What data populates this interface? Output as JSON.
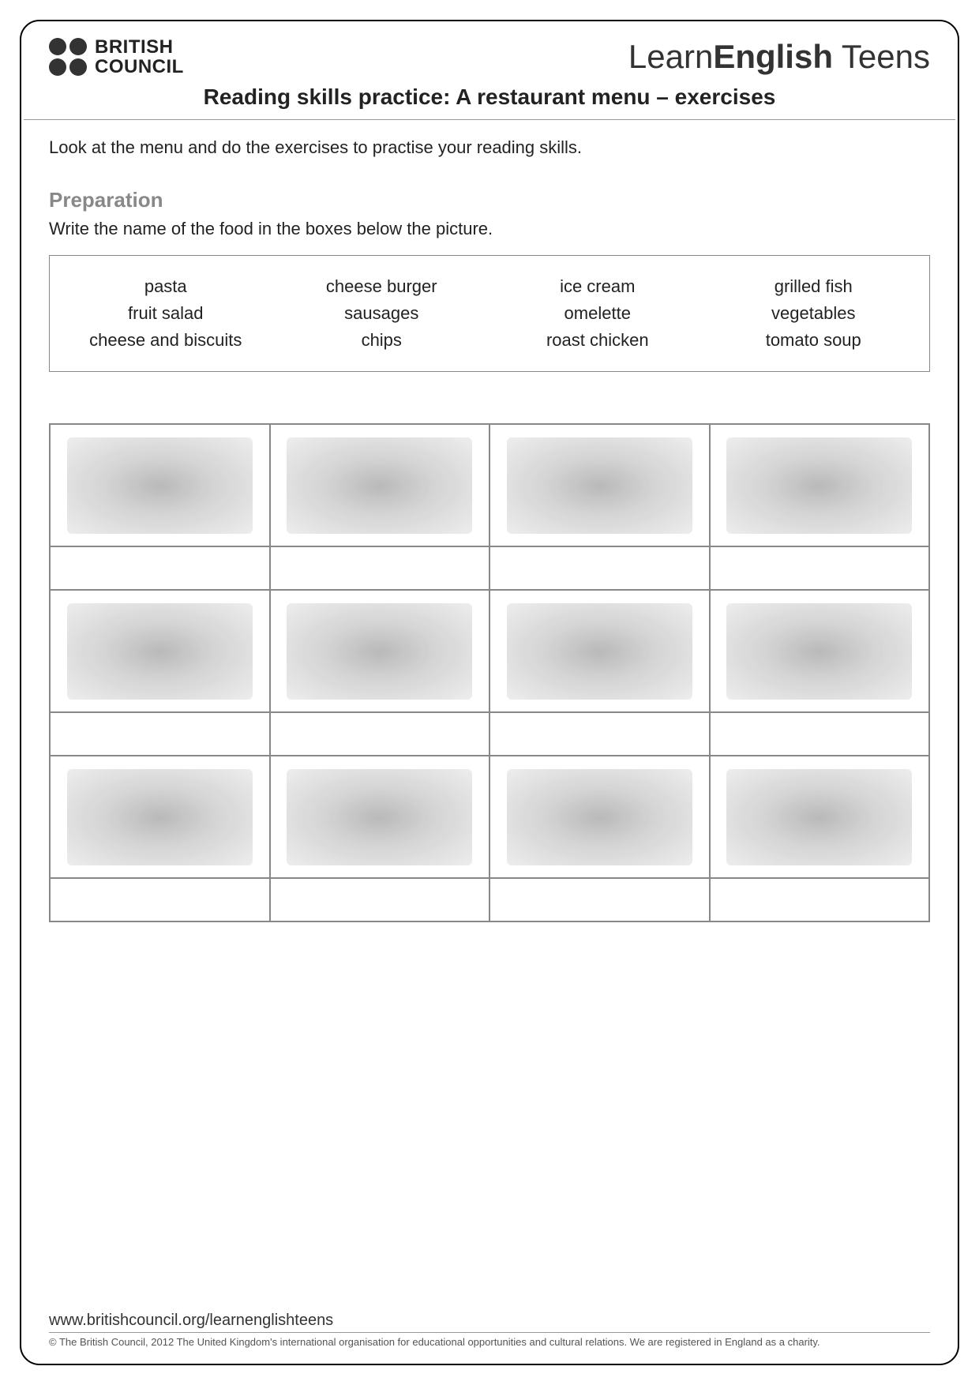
{
  "header": {
    "logo_line1": "BRITISH",
    "logo_line2": "COUNCIL",
    "brand_part1": "Learn",
    "brand_part2": "English",
    "brand_part3": " Teens"
  },
  "title": "Reading skills practice: A restaurant menu – exercises",
  "intro": "Look at the menu and do the exercises to practise your reading skills.",
  "preparation": {
    "heading": "Preparation",
    "instruction": "Write the name of the food in the boxes below the picture."
  },
  "words": {
    "row1": [
      "pasta",
      "cheese burger",
      "ice cream",
      "grilled fish"
    ],
    "row2": [
      "fruit salad",
      "sausages",
      "omelette",
      "vegetables"
    ],
    "row3": [
      "cheese and biscuits",
      "chips",
      "roast chicken",
      "tomato soup"
    ]
  },
  "footer": {
    "url": "www.britishcouncil.org/learnenglishteens",
    "copyright": "© The British Council, 2012 The United Kingdom's international organisation for educational opportunities and cultural relations. We are registered in England as a charity."
  }
}
